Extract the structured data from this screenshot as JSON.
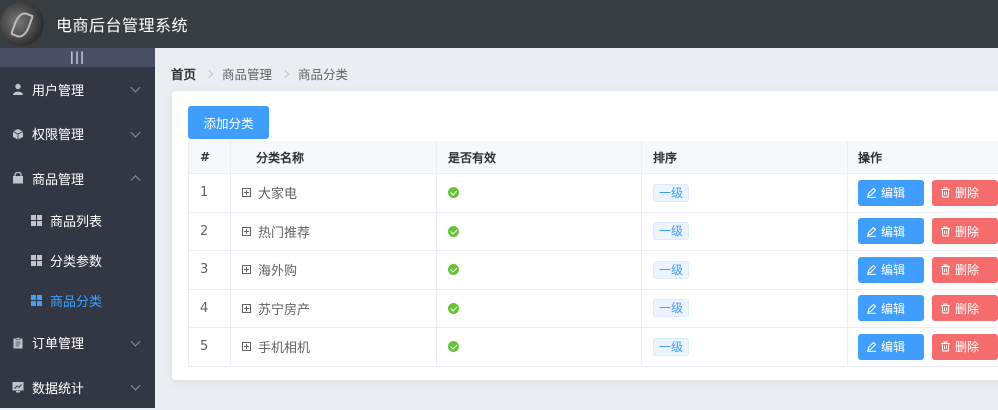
{
  "header": {
    "title": "电商后台管理系统"
  },
  "sidebar": {
    "toggle": "|||",
    "menus": [
      {
        "label": "用户管理",
        "icon": "user-icon"
      },
      {
        "label": "权限管理",
        "icon": "box-icon"
      },
      {
        "label": "商品管理",
        "icon": "shop-icon",
        "expanded": true,
        "children": [
          {
            "label": "商品列表"
          },
          {
            "label": "分类参数"
          },
          {
            "label": "商品分类",
            "active": true
          }
        ]
      },
      {
        "label": "订单管理",
        "icon": "clipboard-icon"
      },
      {
        "label": "数据统计",
        "icon": "chart-icon"
      }
    ]
  },
  "breadcrumb": [
    "首页",
    "商品管理",
    "商品分类"
  ],
  "toolbar": {
    "add_label": "添加分类"
  },
  "table": {
    "columns": [
      "#",
      "分类名称",
      "是否有效",
      "排序",
      "操作"
    ],
    "rows": [
      {
        "idx": "1",
        "name": "大家电",
        "level": "一级"
      },
      {
        "idx": "2",
        "name": "热门推荐",
        "level": "一级"
      },
      {
        "idx": "3",
        "name": "海外购",
        "level": "一级"
      },
      {
        "idx": "4",
        "name": "苏宁房产",
        "level": "一级"
      },
      {
        "idx": "5",
        "name": "手机相机",
        "level": "一级"
      }
    ],
    "edit_label": "编辑",
    "delete_label": "删除"
  },
  "colors": {
    "primary": "#409eff",
    "danger": "#f56c6c",
    "success": "#67c23a",
    "sidebar": "#333744",
    "header": "#373d41"
  }
}
